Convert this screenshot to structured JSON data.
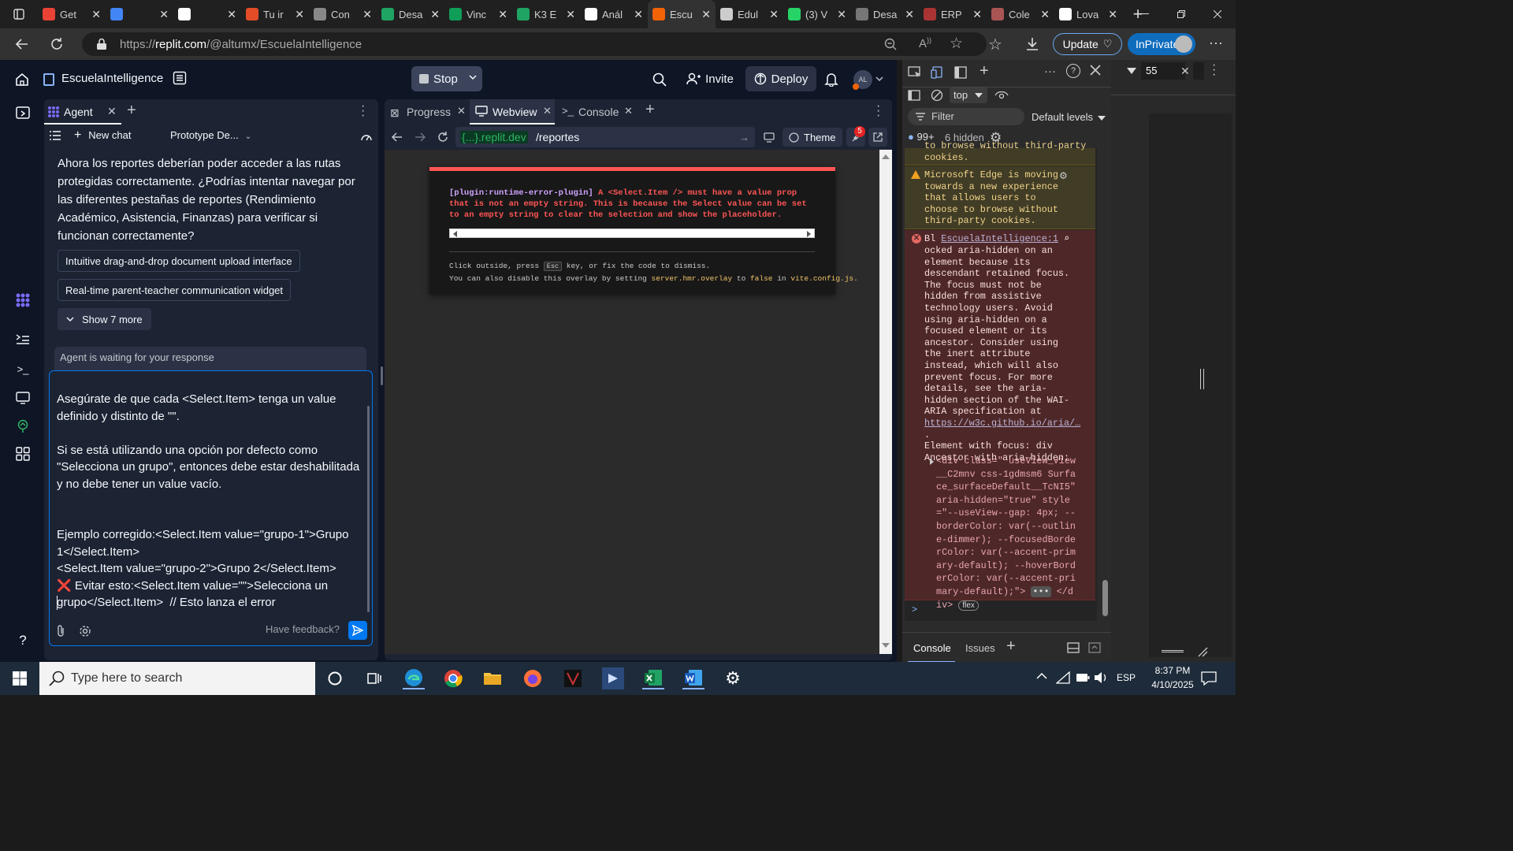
{
  "browser": {
    "tabs": [
      {
        "label": "Get",
        "icon": "gmail-icon",
        "color": "#ea4335"
      },
      {
        "label": "",
        "icon": "docs-icon",
        "color": "#4285f4"
      },
      {
        "label": "",
        "icon": "folder-icon",
        "color": "#ffffff"
      },
      {
        "label": "Tu ir",
        "icon": "app-icon",
        "color": "#e34c26"
      },
      {
        "label": "Con",
        "icon": "window-icon",
        "color": "#888888"
      },
      {
        "label": "Desa",
        "icon": "drive-icon",
        "color": "#1fa463"
      },
      {
        "label": "Vinc",
        "icon": "sheets-icon",
        "color": "#0f9d58"
      },
      {
        "label": "K3 E",
        "icon": "drive-icon",
        "color": "#1fa463"
      },
      {
        "label": "Anál",
        "icon": "openai-icon",
        "color": "#ffffff"
      },
      {
        "label": "Escu",
        "icon": "replit-icon",
        "color": "#f26207",
        "active": true
      },
      {
        "label": "Edul",
        "icon": "globe-icon",
        "color": "#cccccc"
      },
      {
        "label": "(3) V",
        "icon": "whatsapp-icon",
        "color": "#25d366"
      },
      {
        "label": "Desa",
        "icon": "drive-icon",
        "color": "#777777"
      },
      {
        "label": "ERP",
        "icon": "circle-icon",
        "color": "#aa3333"
      },
      {
        "label": "Cole",
        "icon": "apps-icon",
        "color": "#aa5555"
      },
      {
        "label": "Lova",
        "icon": "openai-icon",
        "color": "#ffffff"
      }
    ],
    "url_prefix": "https://",
    "url_domain": "replit.com",
    "url_path": "/@altumx/EscuelaIntelligence",
    "update_label": "Update",
    "inprivate_label": "InPrivate"
  },
  "replit": {
    "project_name": "EscuelaIntelligence",
    "stop_label": "Stop",
    "invite_label": "Invite",
    "deploy_label": "Deploy",
    "avatar_initials": "AL",
    "agent_tab": "Agent",
    "new_chat": "New chat",
    "prototype_label": "Prototype De...",
    "message": "Ahora los reportes deberían poder acceder a las rutas protegidas correctamente. ¿Podrías intentar navegar por las diferentes pestañas de reportes (Rendimiento Académico, Asistencia, Finanzas) para verificar si funcionan correctamente?",
    "suggestions": [
      "Intuitive drag-and-drop document upload interface",
      "Real-time parent-teacher communication widget"
    ],
    "show_more": "Show 7 more",
    "waiting": "Agent is waiting for your response",
    "input_text": "Asegúrate de que cada <Select.Item> tenga un value definido y distinto de \"\".\n\nSi se está utilizando una opción por defecto como \"Selecciona un grupo\", entonces debe estar deshabilitada y no debe tener un value vacío.\n\n\nEjemplo corregido:<Select.Item value=\"grupo-1\">Grupo 1</Select.Item>\n<Select.Item value=\"grupo-2\">Grupo 2</Select.Item>\n❌ Evitar esto:<Select.Item value=\"\">Selecciona un grupo</Select.Item>  // Esto lanza el error",
    "feedback": "Have feedback?",
    "web_tabs": [
      "Progress",
      "Webview",
      "Console"
    ],
    "web_host": "{...}.replit.dev",
    "web_path": "/reportes",
    "theme_label": "Theme",
    "badge_count": "5",
    "error": {
      "plugin": "[plugin:runtime-error-plugin]",
      "message": "A <Select.Item /> must have a value prop that is not an empty string. This is because the Select value can be set to an empty string to clear the selection and show the placeholder.",
      "dismiss_a": "Click outside, press",
      "esc": "Esc",
      "dismiss_b": "key, or fix the code to dismiss.",
      "disable_a": "You can also disable this overlay by setting",
      "setting": "server.hmr.overlay",
      "to": "to",
      "false": "false",
      "in": "in",
      "file": "vite.config.js."
    }
  },
  "devtools": {
    "context": "top",
    "filter": "Filter",
    "levels": "Default levels",
    "msg_count": "99+",
    "hidden": "6 hidden",
    "zoom_value": "55",
    "warn_top": "to browse without third-party cookies.",
    "warn_main": "Microsoft Edge is moving towards a new experience that allows users to choose to browse without third-party cookies.",
    "err_prefix": "Bl",
    "err_link": "EscuelaIntelligence:1",
    "err_text": "ocked aria-hidden on an element because its descendant retained focus. The focus must not be hidden from assistive technology users. Avoid using aria-hidden on a focused element or its ancestor. Consider using the inert attribute instead, which will also prevent focus. For more details, see the aria-hidden section of the WAI-ARIA specification at",
    "err_url": "https://w3c.github.io/aria/…",
    "err_dot": ".",
    "focus_line": "Element with focus: div",
    "ancestor_line": "Ancestor with aria-hidden:",
    "html_snippet": "<div class=\" useView_view__C2mnv css-1gdmsm6 Surface_surfaceDefault__TcNI5\" aria-hidden=\"true\" style=\"--useView--gap: 4px; --borderColor: var(--outline-dimmer); --focusedBorderColor: var(--accent-primary-default); --hoverBorderColor: var(--accent-primary-default);\">",
    "html_tail": "</div>",
    "flex_badge": "flex",
    "bottom_tabs": [
      "Console",
      "Issues"
    ]
  },
  "taskbar": {
    "search_placeholder": "Type here to search",
    "lang": "ESP",
    "time": "8:37 PM",
    "date": "4/10/2025"
  }
}
